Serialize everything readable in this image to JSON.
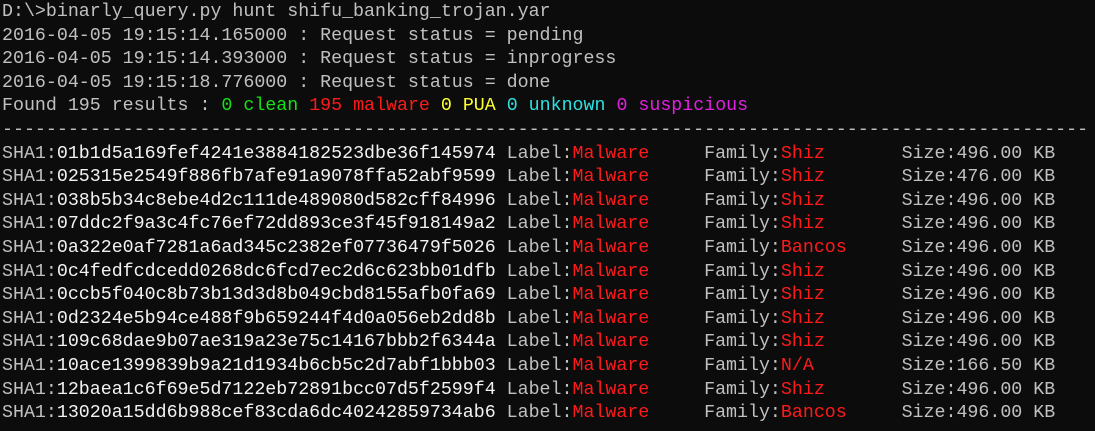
{
  "terminal": {
    "command": "D:\\>binarly_query.py hunt shifu_banking_trojan.yar",
    "status_lines": [
      "2016-04-05 19:15:14.165000 : Request status = pending",
      "2016-04-05 19:15:14.393000 : Request status = inprogress",
      "2016-04-05 19:15:18.776000 : Request status = done"
    ],
    "summary": {
      "prefix": "Found 195 results : ",
      "clean": "0 clean",
      "malware": "195 malware",
      "pua": "0 PUA",
      "unknown": "0 unknown",
      "suspicious": "0 suspicious"
    },
    "separator": "---------------------------------------------------------------------------------------------------",
    "colors": {
      "clean": "#16e016",
      "malware": "#ff1a1a",
      "pua": "#ffff2e",
      "unknown": "#2ee0e0",
      "suspicious": "#e020e0",
      "text": "#c0c0c0",
      "background": "#0c0c0c"
    },
    "results": [
      {
        "sha1": "01b1d5a169fef4241e3884182523dbe36f145974",
        "label": "Malware",
        "family": "Shiz",
        "size": "496.00 KB"
      },
      {
        "sha1": "025315e2549f886fb7afe91a9078ffa52abf9599",
        "label": "Malware",
        "family": "Shiz",
        "size": "476.00 KB"
      },
      {
        "sha1": "038b5b34c8ebe4d2c111de489080d582cff84996",
        "label": "Malware",
        "family": "Shiz",
        "size": "496.00 KB"
      },
      {
        "sha1": "07ddc2f9a3c4fc76ef72dd893ce3f45f918149a2",
        "label": "Malware",
        "family": "Shiz",
        "size": "496.00 KB"
      },
      {
        "sha1": "0a322e0af7281a6ad345c2382ef07736479f5026",
        "label": "Malware",
        "family": "Bancos",
        "size": "496.00 KB"
      },
      {
        "sha1": "0c4fedfcdcedd0268dc6fcd7ec2d6c623bb01dfb",
        "label": "Malware",
        "family": "Shiz",
        "size": "496.00 KB"
      },
      {
        "sha1": "0ccb5f040c8b73b13d3d8b049cbd8155afb0fa69",
        "label": "Malware",
        "family": "Shiz",
        "size": "496.00 KB"
      },
      {
        "sha1": "0d2324e5b94ce488f9b659244f4d0a056eb2dd8b",
        "label": "Malware",
        "family": "Shiz",
        "size": "496.00 KB"
      },
      {
        "sha1": "109c68dae9b07ae319a23e75c14167bbb2f6344a",
        "label": "Malware",
        "family": "Shiz",
        "size": "496.00 KB"
      },
      {
        "sha1": "10ace1399839b9a21d1934b6cb5c2d7abf1bbb03",
        "label": "Malware",
        "family": "N/A",
        "size": "166.50 KB"
      },
      {
        "sha1": "12baea1c6f69e5d7122eb72891bcc07d5f2599f4",
        "label": "Malware",
        "family": "Shiz",
        "size": "496.00 KB"
      },
      {
        "sha1": "13020a15dd6b988cef83cda6dc40242859734ab6",
        "label": "Malware",
        "family": "Bancos",
        "size": "496.00 KB"
      }
    ],
    "field_labels": {
      "sha1": "SHA1:",
      "label": "Label:",
      "family": "Family:",
      "size": "Size:"
    }
  }
}
